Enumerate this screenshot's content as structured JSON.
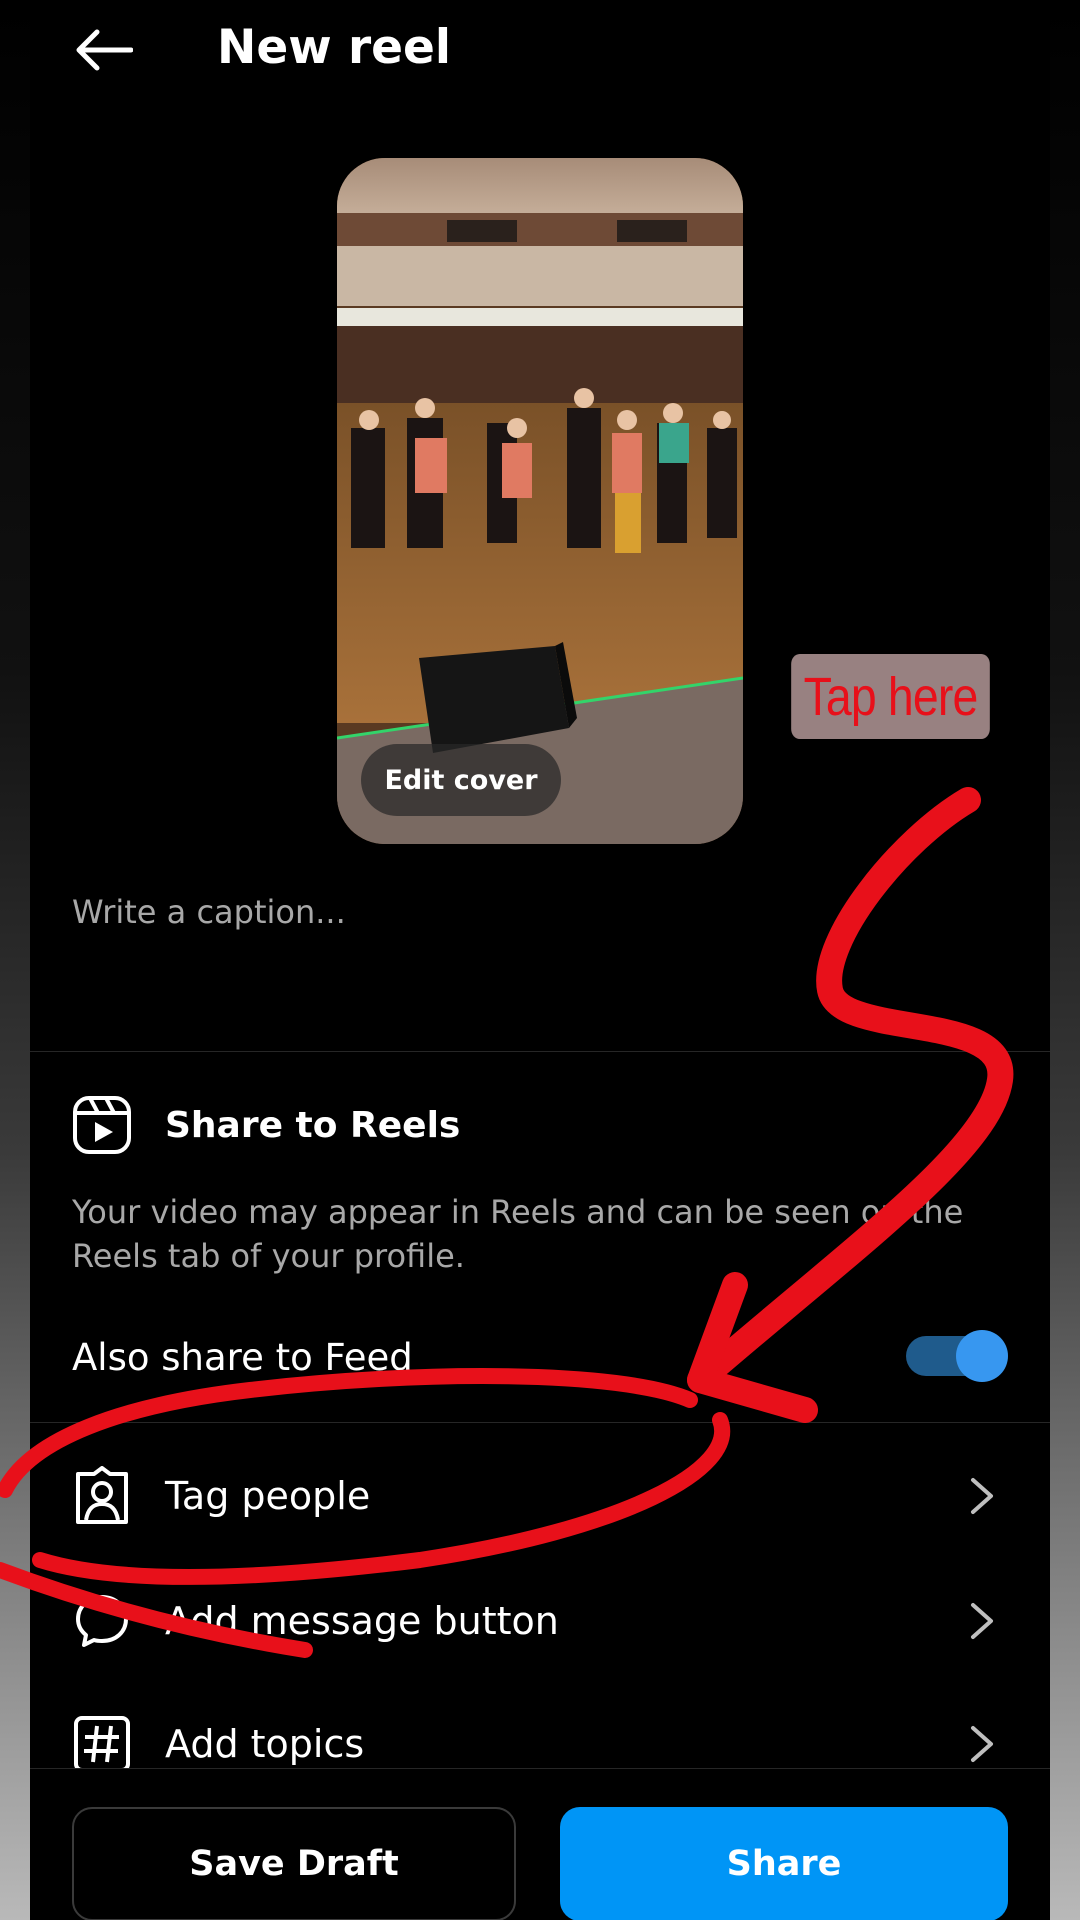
{
  "header": {
    "back_icon": "arrow-left-icon",
    "title": "New reel"
  },
  "preview": {
    "edit_cover_label": "Edit cover"
  },
  "caption": {
    "placeholder": "Write a caption..."
  },
  "share_to_reels": {
    "icon": "reels-icon",
    "title": "Share to Reels",
    "description": "Your video may appear in Reels and can be seen on the Reels tab of your profile."
  },
  "feed_option": {
    "label": "Also share to Feed",
    "enabled": true
  },
  "options": [
    {
      "icon": "tag-person-icon",
      "label": "Tag people"
    },
    {
      "icon": "message-bubble-icon",
      "label": "Add message button"
    },
    {
      "icon": "hashtag-icon",
      "label": "Add topics"
    }
  ],
  "bottom": {
    "save_draft_label": "Save Draft",
    "share_label": "Share"
  },
  "annotation": {
    "tap_here_label": "Tap here",
    "ink_color": "#e8101a"
  },
  "colors": {
    "accent": "#0095f6",
    "toggle_on": "#3797f0",
    "background": "#000000",
    "secondary_text": "#a8a8a8"
  }
}
